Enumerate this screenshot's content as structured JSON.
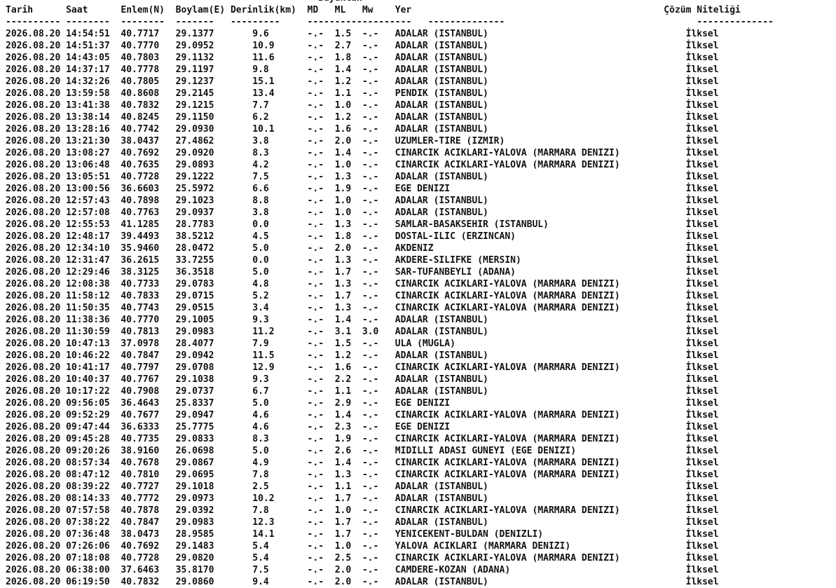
{
  "header": {
    "magnitude_group": "Büyüklük",
    "date": "Tarih",
    "time": "Saat",
    "latitude": "Enlem(N)",
    "longitude": "Boylam(E)",
    "depth": "Derinlik(km)",
    "md": "MD",
    "ml": "ML",
    "mw": "Mw",
    "location": "Yer",
    "solution": "Çözüm Niteliği"
  },
  "rows": [
    [
      "2026.08.20",
      "14:54:51",
      "40.7717",
      "29.1377",
      "9.6",
      "-.-",
      "1.5",
      "-.-",
      "ADALAR (ISTANBUL)",
      "İlksel"
    ],
    [
      "2026.08.20",
      "14:51:37",
      "40.7770",
      "29.0952",
      "10.9",
      "-.-",
      "2.7",
      "-.-",
      "ADALAR (ISTANBUL)",
      "İlksel"
    ],
    [
      "2026.08.20",
      "14:43:05",
      "40.7803",
      "29.1132",
      "11.6",
      "-.-",
      "1.8",
      "-.-",
      "ADALAR (ISTANBUL)",
      "İlksel"
    ],
    [
      "2026.08.20",
      "14:37:17",
      "40.7778",
      "29.1197",
      "9.8",
      "-.-",
      "1.4",
      "-.-",
      "ADALAR (ISTANBUL)",
      "İlksel"
    ],
    [
      "2026.08.20",
      "14:32:26",
      "40.7805",
      "29.1237",
      "15.1",
      "-.-",
      "1.2",
      "-.-",
      "ADALAR (ISTANBUL)",
      "İlksel"
    ],
    [
      "2026.08.20",
      "13:59:58",
      "40.8608",
      "29.2145",
      "13.4",
      "-.-",
      "1.1",
      "-.-",
      "PENDIK (ISTANBUL)",
      "İlksel"
    ],
    [
      "2026.08.20",
      "13:41:38",
      "40.7832",
      "29.1215",
      "7.7",
      "-.-",
      "1.0",
      "-.-",
      "ADALAR (ISTANBUL)",
      "İlksel"
    ],
    [
      "2026.08.20",
      "13:38:14",
      "40.8245",
      "29.1150",
      "6.2",
      "-.-",
      "1.2",
      "-.-",
      "ADALAR (ISTANBUL)",
      "İlksel"
    ],
    [
      "2026.08.20",
      "13:28:16",
      "40.7742",
      "29.0930",
      "10.1",
      "-.-",
      "1.6",
      "-.-",
      "ADALAR (ISTANBUL)",
      "İlksel"
    ],
    [
      "2026.08.20",
      "13:21:30",
      "38.0437",
      "27.4862",
      "3.8",
      "-.-",
      "2.0",
      "-.-",
      "UZUMLER-TIRE (IZMIR)",
      "İlksel"
    ],
    [
      "2026.08.20",
      "13:08:27",
      "40.7692",
      "29.0920",
      "8.3",
      "-.-",
      "1.4",
      "-.-",
      "CINARCIK ACIKLARI-YALOVA (MARMARA DENIZI)",
      "İlksel"
    ],
    [
      "2026.08.20",
      "13:06:48",
      "40.7635",
      "29.0893",
      "4.2",
      "-.-",
      "1.0",
      "-.-",
      "CINARCIK ACIKLARI-YALOVA (MARMARA DENIZI)",
      "İlksel"
    ],
    [
      "2026.08.20",
      "13:05:51",
      "40.7728",
      "29.1222",
      "7.5",
      "-.-",
      "1.3",
      "-.-",
      "ADALAR (ISTANBUL)",
      "İlksel"
    ],
    [
      "2026.08.20",
      "13:00:56",
      "36.6603",
      "25.5972",
      "6.6",
      "-.-",
      "1.9",
      "-.-",
      "EGE DENIZI",
      "İlksel"
    ],
    [
      "2026.08.20",
      "12:57:43",
      "40.7898",
      "29.1023",
      "8.8",
      "-.-",
      "1.0",
      "-.-",
      "ADALAR (ISTANBUL)",
      "İlksel"
    ],
    [
      "2026.08.20",
      "12:57:08",
      "40.7763",
      "29.0937",
      "3.8",
      "-.-",
      "1.0",
      "-.-",
      "ADALAR (ISTANBUL)",
      "İlksel"
    ],
    [
      "2026.08.20",
      "12:55:53",
      "41.1285",
      "28.7783",
      "0.0",
      "-.-",
      "1.3",
      "-.-",
      "SAMLAR-BASAKSEHIR (ISTANBUL)",
      "İlksel"
    ],
    [
      "2026.08.20",
      "12:48:17",
      "39.4493",
      "38.5212",
      "4.5",
      "-.-",
      "1.8",
      "-.-",
      "DOSTAL-ILIC (ERZINCAN)",
      "İlksel"
    ],
    [
      "2026.08.20",
      "12:34:10",
      "35.9460",
      "28.0472",
      "5.0",
      "-.-",
      "2.0",
      "-.-",
      "AKDENIZ",
      "İlksel"
    ],
    [
      "2026.08.20",
      "12:31:47",
      "36.2615",
      "33.7255",
      "0.0",
      "-.-",
      "1.3",
      "-.-",
      "AKDERE-SILIFKE (MERSIN)",
      "İlksel"
    ],
    [
      "2026.08.20",
      "12:29:46",
      "38.3125",
      "36.3518",
      "5.0",
      "-.-",
      "1.7",
      "-.-",
      "SAR-TUFANBEYLI (ADANA)",
      "İlksel"
    ],
    [
      "2026.08.20",
      "12:08:38",
      "40.7733",
      "29.0783",
      "4.8",
      "-.-",
      "1.3",
      "-.-",
      "CINARCIK ACIKLARI-YALOVA (MARMARA DENIZI)",
      "İlksel"
    ],
    [
      "2026.08.20",
      "11:58:12",
      "40.7833",
      "29.0715",
      "5.2",
      "-.-",
      "1.7",
      "-.-",
      "CINARCIK ACIKLARI-YALOVA (MARMARA DENIZI)",
      "İlksel"
    ],
    [
      "2026.08.20",
      "11:50:35",
      "40.7743",
      "29.0515",
      "3.4",
      "-.-",
      "1.3",
      "-.-",
      "CINARCIK ACIKLARI-YALOVA (MARMARA DENIZI)",
      "İlksel"
    ],
    [
      "2026.08.20",
      "11:38:36",
      "40.7770",
      "29.1005",
      "9.3",
      "-.-",
      "1.4",
      "-.-",
      "ADALAR (ISTANBUL)",
      "İlksel"
    ],
    [
      "2026.08.20",
      "11:30:59",
      "40.7813",
      "29.0983",
      "11.2",
      "-.-",
      "3.1",
      "3.0",
      "ADALAR (ISTANBUL)",
      "İlksel"
    ],
    [
      "2026.08.20",
      "10:47:13",
      "37.0978",
      "28.4077",
      "7.9",
      "-.-",
      "1.5",
      "-.-",
      "ULA (MUGLA)",
      "İlksel"
    ],
    [
      "2026.08.20",
      "10:46:22",
      "40.7847",
      "29.0942",
      "11.5",
      "-.-",
      "1.2",
      "-.-",
      "ADALAR (ISTANBUL)",
      "İlksel"
    ],
    [
      "2026.08.20",
      "10:41:17",
      "40.7797",
      "29.0708",
      "12.9",
      "-.-",
      "1.6",
      "-.-",
      "CINARCIK ACIKLARI-YALOVA (MARMARA DENIZI)",
      "İlksel"
    ],
    [
      "2026.08.20",
      "10:40:37",
      "40.7767",
      "29.1038",
      "9.3",
      "-.-",
      "2.2",
      "-.-",
      "ADALAR (ISTANBUL)",
      "İlksel"
    ],
    [
      "2026.08.20",
      "10:17:22",
      "40.7908",
      "29.0737",
      "6.7",
      "-.-",
      "1.1",
      "-.-",
      "ADALAR (ISTANBUL)",
      "İlksel"
    ],
    [
      "2026.08.20",
      "09:56:05",
      "36.4643",
      "25.8337",
      "5.0",
      "-.-",
      "2.9",
      "-.-",
      "EGE DENIZI",
      "İlksel"
    ],
    [
      "2026.08.20",
      "09:52:29",
      "40.7677",
      "29.0947",
      "4.6",
      "-.-",
      "1.4",
      "-.-",
      "CINARCIK ACIKLARI-YALOVA (MARMARA DENIZI)",
      "İlksel"
    ],
    [
      "2026.08.20",
      "09:47:44",
      "36.6333",
      "25.7775",
      "4.6",
      "-.-",
      "2.3",
      "-.-",
      "EGE DENIZI",
      "İlksel"
    ],
    [
      "2026.08.20",
      "09:45:28",
      "40.7735",
      "29.0833",
      "8.3",
      "-.-",
      "1.9",
      "-.-",
      "CINARCIK ACIKLARI-YALOVA (MARMARA DENIZI)",
      "İlksel"
    ],
    [
      "2026.08.20",
      "09:20:26",
      "38.9160",
      "26.0698",
      "5.0",
      "-.-",
      "2.6",
      "-.-",
      "MIDILLI ADASI GUNEYI (EGE DENIZI)",
      "İlksel"
    ],
    [
      "2026.08.20",
      "08:57:34",
      "40.7678",
      "29.0867",
      "4.9",
      "-.-",
      "1.4",
      "-.-",
      "CINARCIK ACIKLARI-YALOVA (MARMARA DENIZI)",
      "İlksel"
    ],
    [
      "2026.08.20",
      "08:47:12",
      "40.7810",
      "29.0695",
      "7.8",
      "-.-",
      "1.3",
      "-.-",
      "CINARCIK ACIKLARI-YALOVA (MARMARA DENIZI)",
      "İlksel"
    ],
    [
      "2026.08.20",
      "08:39:22",
      "40.7727",
      "29.1018",
      "2.5",
      "-.-",
      "1.1",
      "-.-",
      "ADALAR (ISTANBUL)",
      "İlksel"
    ],
    [
      "2026.08.20",
      "08:14:33",
      "40.7772",
      "29.0973",
      "10.2",
      "-.-",
      "1.7",
      "-.-",
      "ADALAR (ISTANBUL)",
      "İlksel"
    ],
    [
      "2026.08.20",
      "07:57:58",
      "40.7878",
      "29.0392",
      "7.8",
      "-.-",
      "1.0",
      "-.-",
      "CINARCIK ACIKLARI-YALOVA (MARMARA DENIZI)",
      "İlksel"
    ],
    [
      "2026.08.20",
      "07:38:22",
      "40.7847",
      "29.0983",
      "12.3",
      "-.-",
      "1.7",
      "-.-",
      "ADALAR (ISTANBUL)",
      "İlksel"
    ],
    [
      "2026.08.20",
      "07:36:48",
      "38.0473",
      "28.9585",
      "14.1",
      "-.-",
      "1.7",
      "-.-",
      "YENICEKENT-BULDAN (DENIZLI)",
      "İlksel"
    ],
    [
      "2026.08.20",
      "07:26:06",
      "40.7692",
      "29.1483",
      "5.4",
      "-.-",
      "1.0",
      "-.-",
      "YALOVA ACIKLARI (MARMARA DENIZI)",
      "İlksel"
    ],
    [
      "2026.08.20",
      "07:18:08",
      "40.7728",
      "29.0820",
      "5.4",
      "-.-",
      "2.5",
      "-.-",
      "CINARCIK ACIKLARI-YALOVA (MARMARA DENIZI)",
      "İlksel"
    ],
    [
      "2026.08.20",
      "06:38:00",
      "37.6463",
      "35.8170",
      "7.5",
      "-.-",
      "2.0",
      "-.-",
      "CAMDERE-KOZAN (ADANA)",
      "İlksel"
    ],
    [
      "2026.08.20",
      "06:19:50",
      "40.7832",
      "29.0860",
      "9.4",
      "-.-",
      "2.0",
      "-.-",
      "ADALAR (ISTANBUL)",
      "İlksel"
    ]
  ]
}
